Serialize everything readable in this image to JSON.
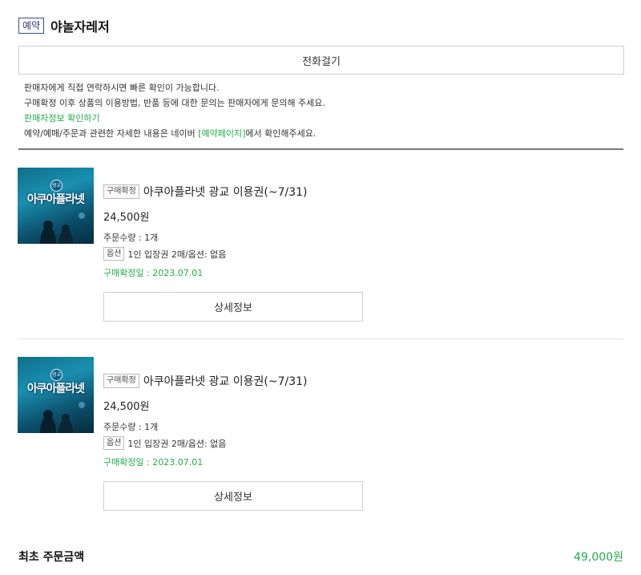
{
  "header": {
    "badge": "예약",
    "seller": "야놀자레저"
  },
  "call_button": "전화걸기",
  "notice": {
    "line1": "판매자에게 직접 연락하시면 빠른 확인이 가능합니다.",
    "line2": "구매확정 이후 상품의 이용방법, 반품 등에 대한 문의는 판매자에게 문의해 주세요.",
    "seller_info_link": "판매자정보 확인하기",
    "line4_pre": "예약/예매/주문과 관련한 자세한 내용은 네이버 ",
    "line4_link": "[예약페이지]",
    "line4_post": "에서 확인해주세요."
  },
  "items": [
    {
      "thumb_tag": "광교",
      "thumb_title": "아쿠아플라넷",
      "status": "구매확정",
      "name": "아쿠아플라넷 광교 이용권(~7/31)",
      "price": "24,500원",
      "quantity": "주문수량 : 1개",
      "option_badge": "옵션",
      "option": "1인 입장권 2매/옵션: 없음",
      "confirm_date": "구매확정일 : 2023.07.01",
      "detail_button": "상세정보"
    },
    {
      "thumb_tag": "광교",
      "thumb_title": "아쿠아플라넷",
      "status": "구매확정",
      "name": "아쿠아플라넷 광교 이용권(~7/31)",
      "price": "24,500원",
      "quantity": "주문수량 : 1개",
      "option_badge": "옵션",
      "option": "1인 입장권 2매/옵션: 없음",
      "confirm_date": "구매확정일 : 2023.07.01",
      "detail_button": "상세정보"
    }
  ],
  "total": {
    "label": "최초 주문금액",
    "value": "49,000원"
  },
  "colors": {
    "accent_green": "#1fae4a",
    "badge_navy": "#2d3a7a"
  }
}
